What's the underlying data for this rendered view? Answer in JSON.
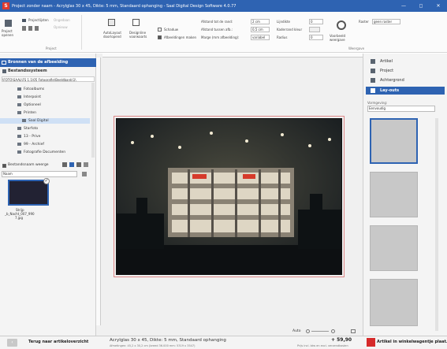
{
  "window": {
    "logo": "S",
    "title": "Project zonder naam - Acrylglas 30 x 45, Dikte: 5 mm, Standaard ophanging - Saal Digital Design Software 4.0.77",
    "minimize": "—",
    "maximize": "◻",
    "close": "✕"
  },
  "ribbon": {
    "project_open": "Project openen",
    "project_list": "Projectlijsten",
    "undo": "Ongedaan",
    "redo": "Opnieuw",
    "group_project": "Project",
    "auto_layout": "AutoLayout doorlopend",
    "design_line": "Designline voorwaarts",
    "helper_line": "Schaduw",
    "clip_photos": "Afbeeldingen maken",
    "dist_edge_label": "Afstand tot de rand:",
    "dist_edge_value": "2 cm",
    "dist_photos_label": "Afstand tussen afb.:",
    "dist_photos_value": "0,5 cm",
    "margin_label": "Marge (mm afbeelding):",
    "margin_value": "variabel",
    "line_width_label": "Lijndikte",
    "line_width_value": "0",
    "frame_color_label": "Kaderrand kleur",
    "radius_label": "Radius",
    "radius_value": "0",
    "preview": "Voorbeeld weergave",
    "grid_label": "Raster",
    "grid_value": "geen raster",
    "group_view": "Weergave"
  },
  "left_panel": {
    "header": "Bronnen van de afbeelding",
    "filesystem": "Bestandssysteem",
    "path": "\\FOTO\\SAAL\\FS 1.1\\05 Fotografie\\Beeldbank\\1\\",
    "tree": [
      {
        "label": "Fotoalbums",
        "sel": false
      },
      {
        "label": "Interpoint",
        "sel": false
      },
      {
        "label": "Optioneel",
        "sel": false
      },
      {
        "label": "Printen",
        "sel": false
      },
      {
        "label": "Saal Digital",
        "sel": true
      },
      {
        "label": "Starfoto",
        "sel": false
      },
      {
        "label": "13 - Prive",
        "sel": false
      },
      {
        "label": "99 - Archief",
        "sel": false
      },
      {
        "label": "Fotografie Documenten",
        "sel": false
      }
    ],
    "show_filenames": "Bestandsnaam weerge",
    "sort_label": "Naam",
    "thumb_caption": "Strijp",
    "thumb_filename": "_b_Nacht_007_990",
    "thumb_ext": "7.jpg"
  },
  "canvas": {
    "zoom_label": "Auto"
  },
  "right_panel": {
    "menu": [
      {
        "label": "Artikel",
        "sel": false
      },
      {
        "label": "Project",
        "sel": false
      },
      {
        "label": "Achtergrond",
        "sel": false
      },
      {
        "label": "Lay-outs",
        "sel": true
      }
    ],
    "layout_type_label": "Vormgeving:",
    "layout_type_value": "Eenvoudig"
  },
  "footer": {
    "back_label": "Terug naar artikeloverzicht",
    "product": "Acrylglas 30 x 45, Dikte: 5 mm, Standaard ophanging",
    "product_details": "Afmetingen: 45,2 x 30,2 cm (breed 36.000 mm: 5319 x 3547)",
    "price": "+ 59,90",
    "price_note": "Prijs incl. btw en excl. verzendkosten",
    "cart_label": "Artikel in winkelwagentje plaat."
  },
  "colors": {
    "accent": "#2e63b2",
    "cart": "#d62a2a"
  }
}
